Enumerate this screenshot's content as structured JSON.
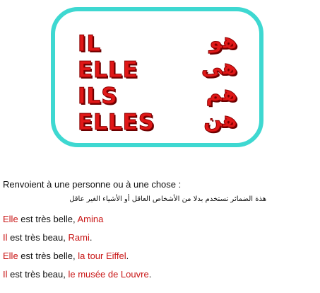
{
  "card": {
    "rows": [
      {
        "fr": "IL",
        "ar": "هو"
      },
      {
        "fr": "ELLE",
        "ar": "هى"
      },
      {
        "fr": "ILS",
        "ar": "هم"
      },
      {
        "fr": "ELLES",
        "ar": "هن"
      }
    ]
  },
  "text": {
    "intro": "Renvoient à une personne ou à une chose :",
    "arabic_note": "هذة الضمائر تستخدم بدلا من الأشخاص العاقل أو الأشياء الغير عاقل",
    "examples": [
      {
        "pronoun": "Elle",
        "middle": " est très belle, ",
        "noun": "Amina",
        "end": ""
      },
      {
        "pronoun": "Il",
        "middle": " est très beau,  ",
        "noun": "Rami",
        "end": "."
      },
      {
        "pronoun": "Elle",
        "middle": " est très belle, ",
        "noun": "la tour Eiffel",
        "end": "."
      },
      {
        "pronoun": "Il",
        "middle": " est très beau, ",
        "noun": "le musée de Louvre",
        "end": "."
      }
    ]
  },
  "colors": {
    "border": "#3ed8d1",
    "accent_red": "#c81414"
  }
}
